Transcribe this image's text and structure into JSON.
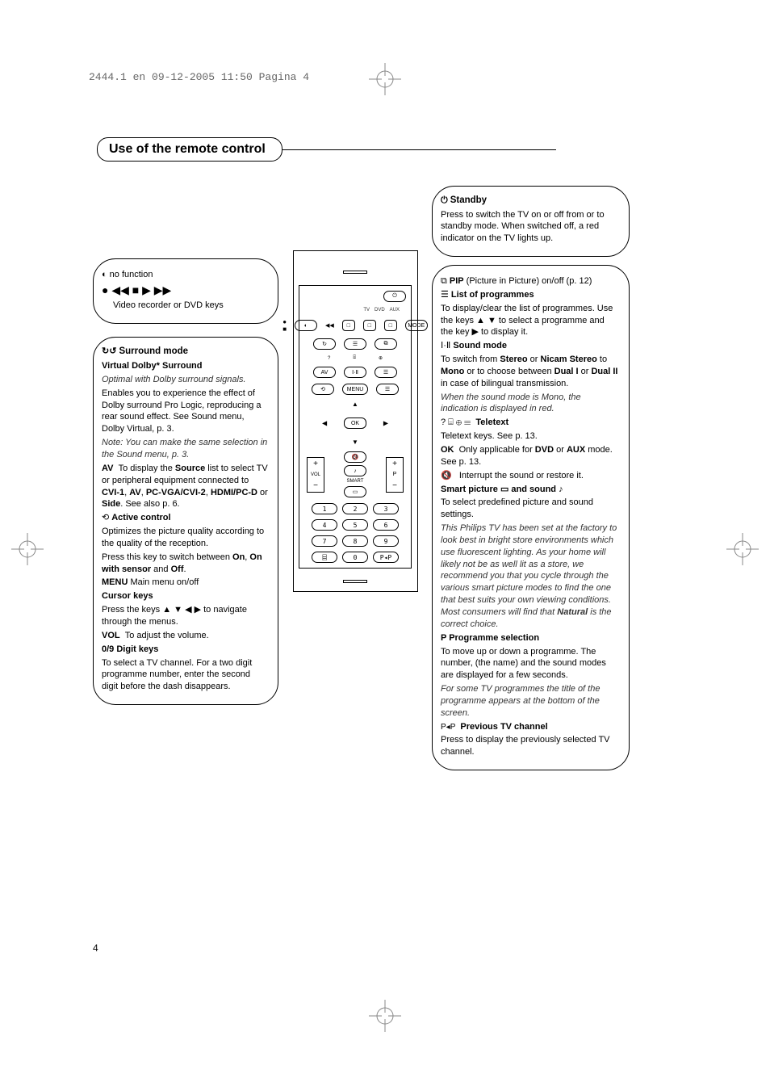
{
  "header": "2444.1 en  09-12-2005  11:50  Pagina 4",
  "title": "Use of the remote control",
  "page_number": "4",
  "left": {
    "nofunc": {
      "icon": "◐",
      "text": "no function"
    },
    "vcr": {
      "symbols": "● ◀◀ ■ ▶ ▶▶",
      "text": "Video recorder or DVD keys"
    },
    "surround": {
      "icon": "↻↺",
      "h": "Surround mode",
      "sub": "Virtual Dolby* Surround",
      "note1": "Optimal with Dolby surround signals.",
      "body": "Enables you to experience the effect of Dolby surround Pro Logic, reproducing a rear sound effect. See Sound menu, Dolby Virtual, p. 3.",
      "note2": "Note: You can make the same selection in the Sound menu, p. 3.",
      "av_label": "AV",
      "av_body": "To display the Source list to select TV or peripheral equipment connected to CVI-1, AV, PC-VGA/CVI-2,  HDMI/PC-D or Side. See also p. 6.",
      "active_icon": "⟲",
      "active_h": "Active control",
      "active_body": "Optimizes the picture quality according to the quality of the reception.",
      "active_body2": "Press this key to switch between On, On with sensor and Off.",
      "menu_label": "MENU",
      "menu_body": "Main menu on/off",
      "cursor_h": "Cursor keys",
      "cursor_body": "Press the keys ▲ ▼ ◀ ▶  to navigate through the menus.",
      "vol_label": "VOL",
      "vol_body": "To adjust the volume.",
      "digits_h": "0/9   Digit keys",
      "digits_body": "To select a TV channel. For a two digit programme number, enter the second digit before the dash disappears."
    }
  },
  "right": {
    "standby": {
      "icon": "⏻",
      "h": "Standby",
      "body": "Press to switch the TV on or off from or to standby mode. When switched off, a red indicator on the TV lights up."
    },
    "pip": {
      "icon": "⧉",
      "h": "PIP",
      "body": "(Picture in Picture) on/off (p. 12)"
    },
    "list": {
      "icon": "☰",
      "h": "List of programmes",
      "body": "To display/clear the list of programmes. Use the keys ▲ ▼ to select a programme and the key ▶ to display it."
    },
    "soundmode": {
      "icon": "Ⅰ·Ⅱ",
      "h": "Sound mode",
      "body": "To switch from Stereo or Nicam Stereo to Mono or to choose between Dual I or Dual II in case of bilingual transmission.",
      "note": "When the sound mode is Mono, the indication is displayed in red."
    },
    "teletext": {
      "icons": "? ⌸ ⊕ ☰",
      "h": "Teletext",
      "body": "Teletext keys. See p. 13."
    },
    "ok": {
      "h": "OK",
      "body": "Only applicable for DVD or AUX mode. See p. 13."
    },
    "mute": {
      "icon": "🔇",
      "body": "Interrupt the sound or restore it."
    },
    "smart": {
      "h": "Smart picture ▭ and sound ♪",
      "body": "To select predefined picture and sound settings.",
      "note": "This Philips TV has been set at the factory to look best in bright store environments which use fluorescent lighting. As your home will likely not be as well lit as a store, we recommend you that you cycle through the various smart picture modes to find the one that best suits your own viewing conditions. Most consumers will find that Natural is the correct choice."
    },
    "prog": {
      "h": "P   Programme selection",
      "body": "To move up or down a programme. The number, (the name) and the sound modes are displayed for a few seconds.",
      "note": "For some TV programmes the title of the programme appears at the bottom of the screen."
    },
    "prev": {
      "icon": "P◂P",
      "h": "Previous TV channel",
      "body": "Press to display the previously selected TV channel."
    }
  },
  "remote": {
    "mode": "MODE",
    "labels": [
      "TV",
      "DVD",
      "AUX"
    ],
    "row2": [
      "↻",
      "☰",
      "⧉"
    ],
    "row3_icons": [
      "?",
      "⌸",
      "⊕"
    ],
    "row3": [
      "AV",
      "Ⅰ·Ⅱ",
      "☰"
    ],
    "row4": [
      "⟲",
      "MENU",
      "☰"
    ],
    "ok": "OK",
    "vol": "VOL",
    "p": "P",
    "mute": "🔇",
    "smart": "SMART",
    "smart_pic": "▭",
    "smart_snd": "♪",
    "digits": [
      "1",
      "2",
      "3",
      "4",
      "5",
      "6",
      "7",
      "8",
      "9"
    ],
    "bottom": [
      "⌸",
      "0",
      "P◂P"
    ]
  }
}
